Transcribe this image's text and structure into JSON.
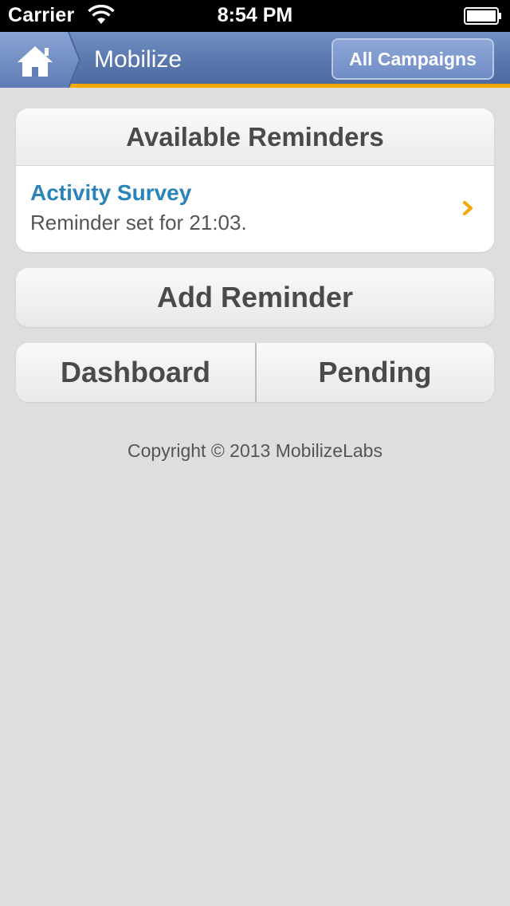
{
  "status_bar": {
    "carrier": "Carrier",
    "time": "8:54 PM",
    "icons": [
      "wifi-icon",
      "battery-icon"
    ]
  },
  "nav": {
    "title": "Mobilize",
    "home_icon": "home-icon",
    "all_campaigns_label": "All Campaigns",
    "accent_color": "#f6a800",
    "bar_color": "#5a78ae"
  },
  "reminders": {
    "header": "Available Reminders",
    "items": [
      {
        "title": "Activity Survey",
        "subtitle": "Reminder set for 21:03.",
        "icon": "chevron-right-icon"
      }
    ]
  },
  "actions": {
    "add_reminder_label": "Add Reminder",
    "dashboard_label": "Dashboard",
    "pending_label": "Pending"
  },
  "footer": {
    "copyright": "Copyright © 2013 MobilizeLabs"
  }
}
